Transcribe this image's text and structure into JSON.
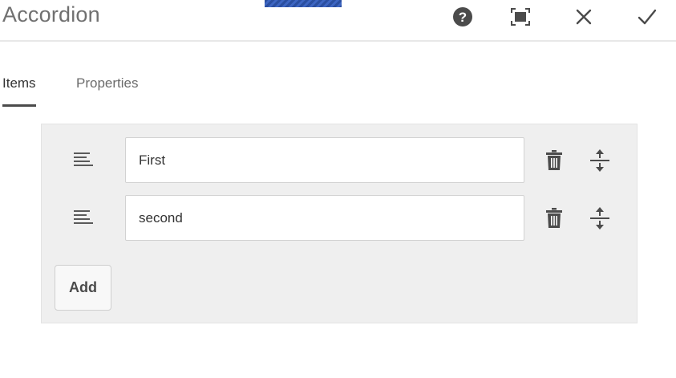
{
  "dialog": {
    "title": "Accordion",
    "header_buttons": [
      {
        "name": "help",
        "icon": "help-circle-icon"
      },
      {
        "name": "fullscreen",
        "icon": "fullscreen-icon"
      },
      {
        "name": "cancel",
        "icon": "close-icon"
      },
      {
        "name": "done",
        "icon": "checkmark-icon"
      }
    ]
  },
  "tabs": [
    {
      "label": "Items",
      "active": true
    },
    {
      "label": "Properties",
      "active": false
    }
  ],
  "items": [
    {
      "value": "First",
      "handle_icon": "reorder-handle-icon",
      "delete_icon": "trash-icon",
      "move_icon": "move-vertical-icon"
    },
    {
      "value": "second",
      "handle_icon": "reorder-handle-icon",
      "delete_icon": "trash-icon",
      "move_icon": "move-vertical-icon"
    }
  ],
  "add_button": {
    "label": "Add"
  },
  "colors": {
    "icon": "#4b4b4b",
    "panel_bg": "#efefef",
    "accent_handle": "#2b4fa0"
  }
}
